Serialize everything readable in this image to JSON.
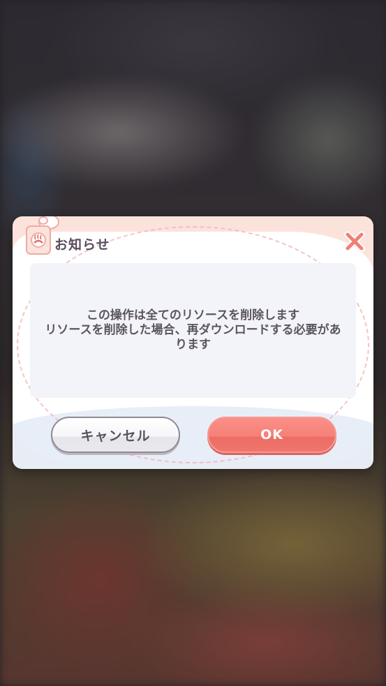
{
  "dialog": {
    "title": "お知らせ",
    "message": "この操作は全てのリソースを削除します\nリソースを削除した場合、再ダウンロードする必要があ\nります",
    "cancel_label": "キャンセル",
    "ok_label": "OK"
  },
  "icons": {
    "title": "hot-spring-bath-icon",
    "close": "close-x-icon"
  },
  "colors": {
    "accent": "#f5817a",
    "title_text": "#5a4d5e",
    "dialog_header": "#fbe3dc",
    "message_box": "#f3f4f9"
  }
}
